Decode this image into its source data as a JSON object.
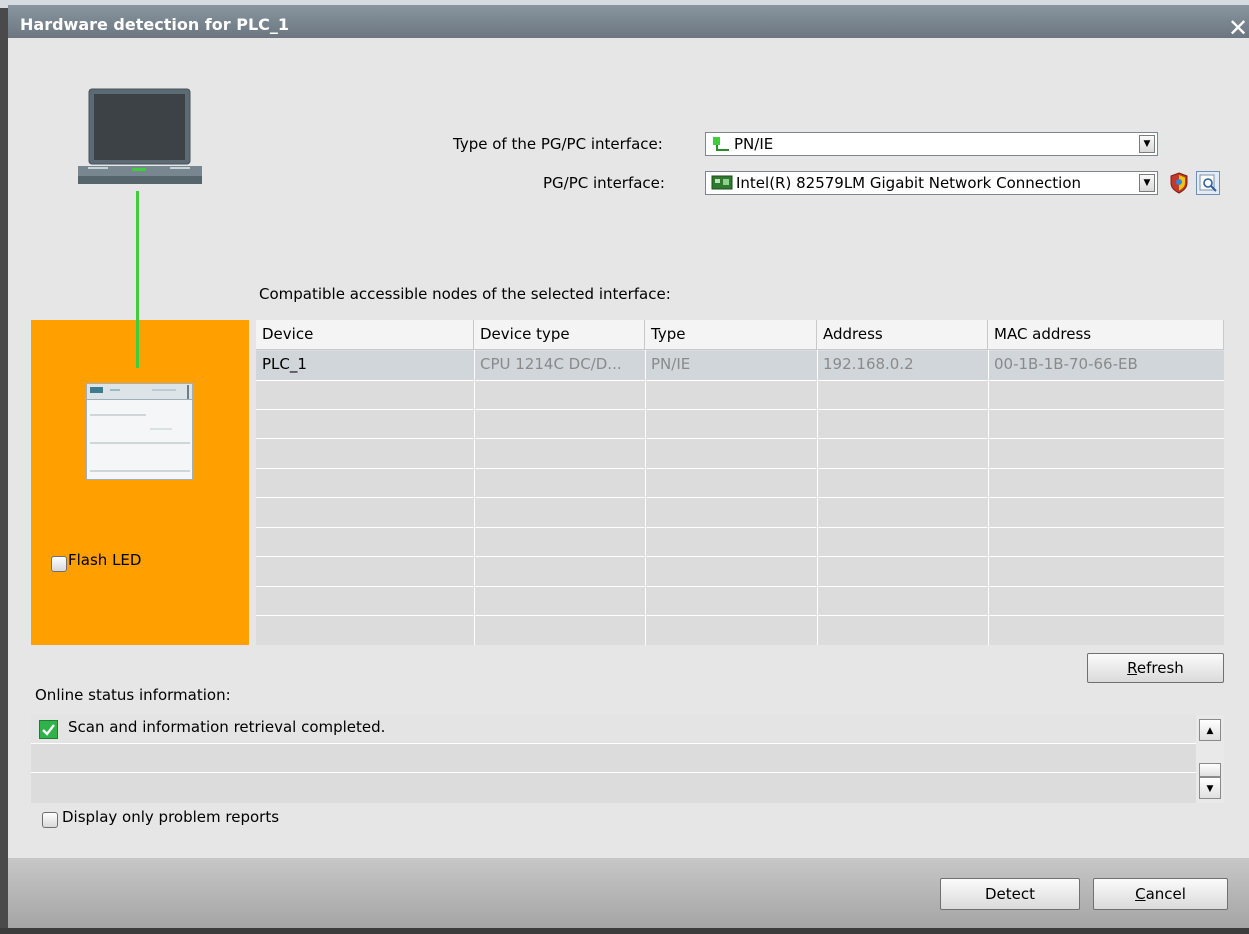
{
  "window": {
    "title": "Hardware detection for PLC_1",
    "close_glyph": "✕"
  },
  "interface": {
    "type_label": "Type of the PG/PC interface:",
    "type_value": "PN/IE",
    "pgpc_label": "PG/PC interface:",
    "pgpc_value": "Intel(R) 82579LM Gigabit Network Connection"
  },
  "nodes": {
    "heading": "Compatible accessible nodes of the selected interface:",
    "columns": [
      "Device",
      "Device type",
      "Type",
      "Address",
      "MAC address"
    ],
    "rows": [
      [
        "PLC_1",
        "CPU 1214C DC/D...",
        "PN/IE",
        "192.168.0.2",
        "00-1B-1B-70-66-EB"
      ]
    ]
  },
  "flash_led": {
    "label": "Flash LED",
    "checked": false
  },
  "refresh_button": {
    "accel": "R",
    "rest": "efresh"
  },
  "status": {
    "heading": "Online status information:",
    "messages": [
      "Scan and information retrieval completed."
    ]
  },
  "problem_reports": {
    "label": "Display only problem reports",
    "checked": false
  },
  "buttons": {
    "detect": "Detect",
    "cancel_accel": "C",
    "cancel_rest": "ancel"
  },
  "colors": {
    "accent_orange": "#ff9f00",
    "link_green": "#3fcc3f",
    "title_bar": "#7b8791"
  },
  "icons": {
    "pc": "laptop-icon",
    "plc": "plc-module-icon",
    "interface_type": "network-plug-icon",
    "nic": "network-card-icon",
    "properties": "shield-icon",
    "search": "magnifier-icon",
    "status_ok": "checkmark-icon"
  }
}
